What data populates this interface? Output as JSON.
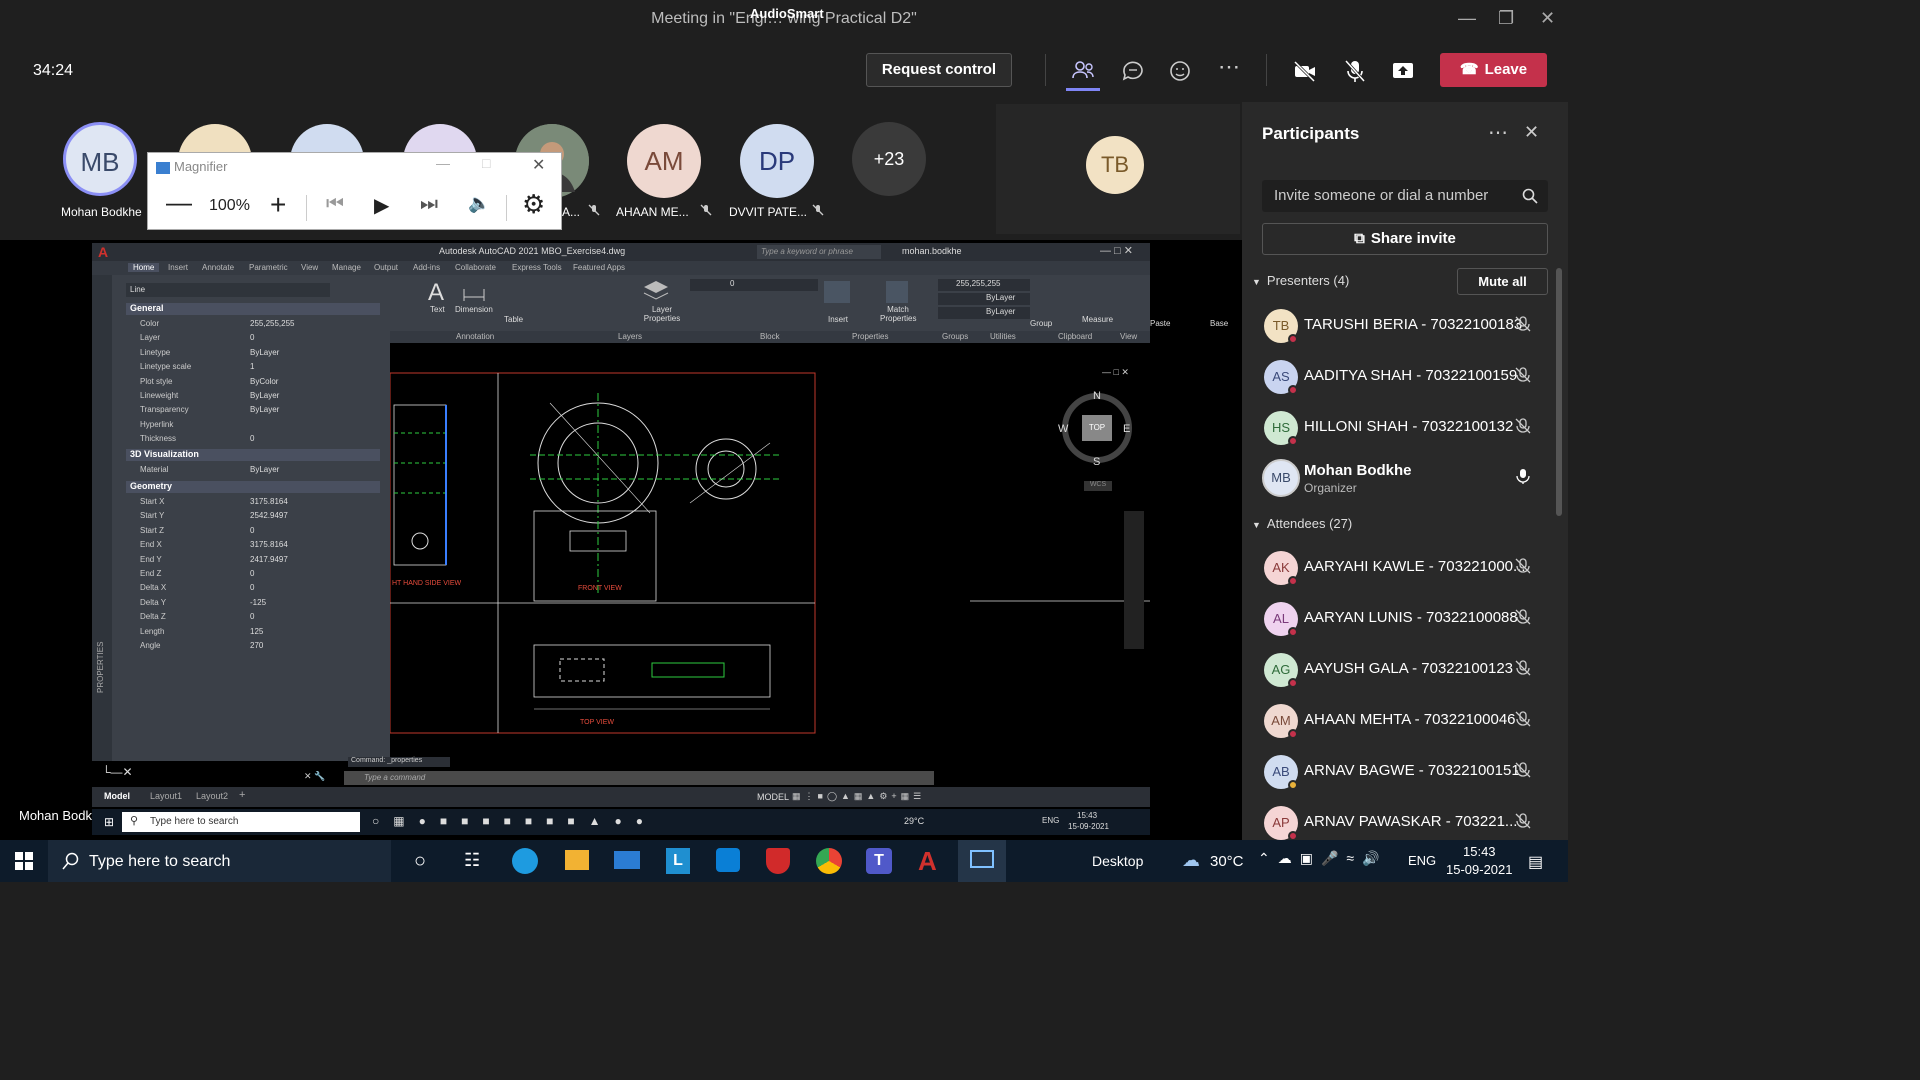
{
  "window": {
    "title": "Meeting in \"Engi… wing Practical D2\"",
    "overlay": "AudioSmart"
  },
  "toolbar": {
    "timer": "34:24",
    "request_control": "Request control",
    "leave": "Leave"
  },
  "stage": {
    "avatars": [
      {
        "initials": "MB",
        "name": "Mohan Bodkhe"
      },
      {
        "initials": "AM",
        "name": "AHAAN ME..."
      },
      {
        "initials": "DP",
        "name": "DVVIT PATE..."
      },
      {
        "initials": "+23",
        "name": ""
      },
      {
        "initials": "TB",
        "name": ""
      }
    ],
    "partial_name": "A...",
    "bottom_name": "Mohan Bodkhe"
  },
  "magnifier": {
    "title": "Magnifier",
    "zoom": "100%"
  },
  "cad": {
    "title": "Autodesk AutoCAD 2021   MBO_Exercise4.dwg",
    "search_placeholder": "Type a keyword or phrase",
    "user": "mohan.bodkhe",
    "ribbon_tabs": [
      "Home",
      "Insert",
      "Annotate",
      "Parametric",
      "View",
      "Manage",
      "Output",
      "Add-ins",
      "Collaborate",
      "Express Tools",
      "Featured Apps"
    ],
    "ribbon_groups": [
      "Annotation",
      "Layers",
      "Block",
      "Properties",
      "Groups",
      "Utilities",
      "Clipboard",
      "View"
    ],
    "ribbon_tools": [
      "Text",
      "Dimension",
      "Table",
      "Layer Properties",
      "Insert",
      "Match Properties",
      "Group",
      "Measure",
      "Paste",
      "Base"
    ],
    "prop_color": "255,255,255",
    "prop_layer": "0",
    "bylayer": "ByLayer",
    "props_type": "Line",
    "sections": {
      "general": "General",
      "viz": "3D Visualization",
      "geometry": "Geometry"
    },
    "general_rows": [
      [
        "Color",
        "255,255,255"
      ],
      [
        "Layer",
        "0"
      ],
      [
        "Linetype",
        "ByLayer"
      ],
      [
        "Linetype scale",
        "1"
      ],
      [
        "Plot style",
        "ByColor"
      ],
      [
        "Lineweight",
        "ByLayer"
      ],
      [
        "Transparency",
        "ByLayer"
      ],
      [
        "Hyperlink",
        ""
      ],
      [
        "Thickness",
        "0"
      ]
    ],
    "viz_rows": [
      [
        "Material",
        "ByLayer"
      ]
    ],
    "geometry_rows": [
      [
        "Start X",
        "3175.8164"
      ],
      [
        "Start Y",
        "2542.9497"
      ],
      [
        "Start Z",
        "0"
      ],
      [
        "End X",
        "3175.8164"
      ],
      [
        "End Y",
        "2417.9497"
      ],
      [
        "End Z",
        "0"
      ],
      [
        "Delta X",
        "0"
      ],
      [
        "Delta Y",
        "-125"
      ],
      [
        "Delta Z",
        "0"
      ],
      [
        "Length",
        "125"
      ],
      [
        "Angle",
        "270"
      ]
    ],
    "views": {
      "rhs": "HT HAND SIDE VIEW",
      "front": "FRONT VIEW",
      "top": "TOP VIEW"
    },
    "compass": {
      "n": "N",
      "s": "S",
      "e": "E",
      "w": "W",
      "top": "TOP",
      "wcs": "WCS"
    },
    "command_last": "Command: _properties",
    "command_placeholder": "Type a command",
    "layout_tabs": [
      "Model",
      "Layout1",
      "Layout2"
    ],
    "status_model": "MODEL",
    "side_label": "PROPERTIES",
    "inner_taskbar": {
      "search": "Type here to search",
      "temp": "29°C",
      "lang": "ENG",
      "time": "15:43",
      "date": "15-09-2021"
    }
  },
  "panel": {
    "title": "Participants",
    "invite_placeholder": "Invite someone or dial a number",
    "share_invite": "Share invite",
    "presenters_label": "Presenters (4)",
    "mute_all": "Mute all",
    "attendees_label": "Attendees (27)",
    "presenters": [
      {
        "initials": "TB",
        "name": "TARUSHI BERIA - 70322100183",
        "color": "#f2e2c4",
        "text": "#7a5a2a"
      },
      {
        "initials": "AS",
        "name": "AADITYA SHAH - 70322100159",
        "color": "#c9d4f0",
        "text": "#3a4a7a"
      },
      {
        "initials": "HS",
        "name": "HILLONI SHAH - 70322100132",
        "color": "#cfe8d2",
        "text": "#2f6b3a"
      },
      {
        "initials": "MB",
        "name": "Mohan Bodkhe",
        "role": "Organizer",
        "color": "#dfe6f3",
        "text": "#3a4a6a"
      }
    ],
    "attendees": [
      {
        "initials": "AK",
        "name": "AARYAHI KAWLE - 703221000...",
        "color": "#f5d5d5",
        "text": "#8a3a3a"
      },
      {
        "initials": "AL",
        "name": "AARYAN LUNIS - 70322100088",
        "color": "#efd3ef",
        "text": "#7a3a7a"
      },
      {
        "initials": "AG",
        "name": "AAYUSH GALA - 70322100123",
        "color": "#cfe8d2",
        "text": "#2f6b3a"
      },
      {
        "initials": "AM",
        "name": "AHAAN MEHTA - 70322100046",
        "color": "#efd8d0",
        "text": "#7a4a3a"
      },
      {
        "initials": "AB",
        "name": "ARNAV BAGWE - 70322100151",
        "color": "#d0dcf0",
        "text": "#3a4a7a"
      },
      {
        "initials": "AP",
        "name": "ARNAV PAWASKAR - 703221...",
        "color": "#f5d5d5",
        "text": "#8a3a3a"
      }
    ]
  },
  "taskbar": {
    "search": "Type here to search",
    "desktop": "Desktop",
    "temp": "30°C",
    "lang": "ENG",
    "time": "15:43",
    "date": "15-09-2021"
  }
}
